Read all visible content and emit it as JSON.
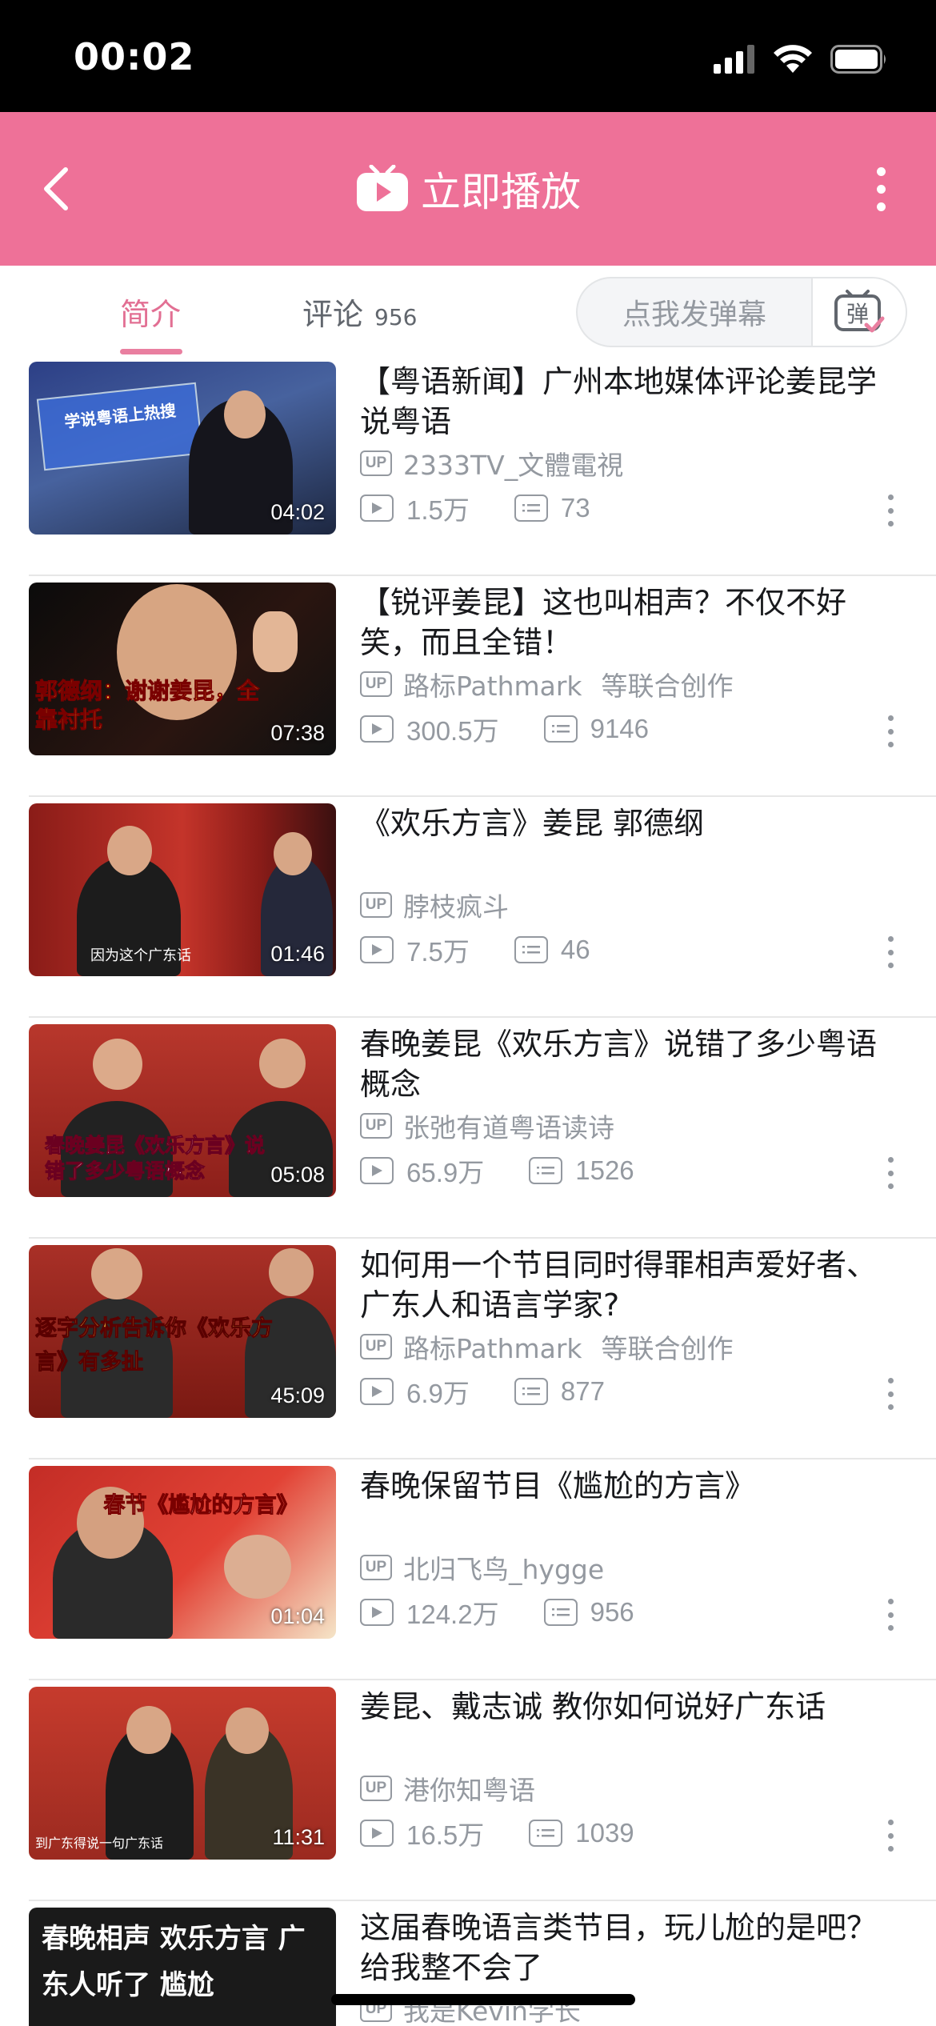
{
  "status_bar": {
    "time": "00:02"
  },
  "header": {
    "title": "立即播放"
  },
  "tabs": {
    "intro_label": "简介",
    "comments_label": "评论",
    "comments_count": "956"
  },
  "danmaku": {
    "placeholder": "点我发弹幕",
    "toggle_label": "弹"
  },
  "colors": {
    "accent": "#ee7198",
    "tab_active": "#e26f93",
    "meta_gray": "#9499a0"
  },
  "videos": [
    {
      "title": "【粤语新闻】广州本地媒体评论姜昆学说粤语",
      "uploader": "2333TV_文體電視",
      "coop": "",
      "views": "1.5万",
      "danmaku": "73",
      "duration": "04:02",
      "thumb_caption": "学说粤语上热搜"
    },
    {
      "title": "【锐评姜昆】这也叫相声？不仅不好笑，而且全错！",
      "uploader": "路标Pathmark",
      "coop": "等联合创作",
      "views": "300.5万",
      "danmaku": "9146",
      "duration": "07:38",
      "thumb_caption": "郭德纲：谢谢姜昆，全靠衬托"
    },
    {
      "title": "《欢乐方言》姜昆  郭德纲",
      "uploader": "脖枝疯斗",
      "coop": "",
      "views": "7.5万",
      "danmaku": "46",
      "duration": "01:46",
      "thumb_caption": "因为这个广东话"
    },
    {
      "title": "春晚姜昆《欢乐方言》说错了多少粤语概念",
      "uploader": "张弛有道粤语读诗",
      "coop": "",
      "views": "65.9万",
      "danmaku": "1526",
      "duration": "05:08",
      "thumb_caption": "春晚姜昆《欢乐方言》说错了多少粤语概念"
    },
    {
      "title": "如何用一个节目同时得罪相声爱好者、广东人和语言学家?",
      "uploader": "路标Pathmark",
      "coop": "等联合创作",
      "views": "6.9万",
      "danmaku": "877",
      "duration": "45:09",
      "thumb_caption": "逐字分析告诉你《欢乐方言》有多扯"
    },
    {
      "title": "春晚保留节目《尴尬的方言》",
      "uploader": "北归飞鸟_hygge",
      "coop": "",
      "views": "124.2万",
      "danmaku": "956",
      "duration": "01:04",
      "thumb_caption": "春节《尴尬的方言》"
    },
    {
      "title": "姜昆、戴志诚  教你如何说好广东话",
      "uploader": "港你知粤语",
      "coop": "",
      "views": "16.5万",
      "danmaku": "1039",
      "duration": "11:31",
      "thumb_caption": "到广东得说一句广东话"
    },
    {
      "title": "这届春晚语言类节目，玩儿尬的是吧？给我整不会了",
      "uploader": "我是Kevin学长",
      "coop": "",
      "views": "",
      "danmaku": "",
      "duration": "",
      "thumb_caption": "春晚相声 欢乐方言 广东人听了 尴尬"
    }
  ]
}
